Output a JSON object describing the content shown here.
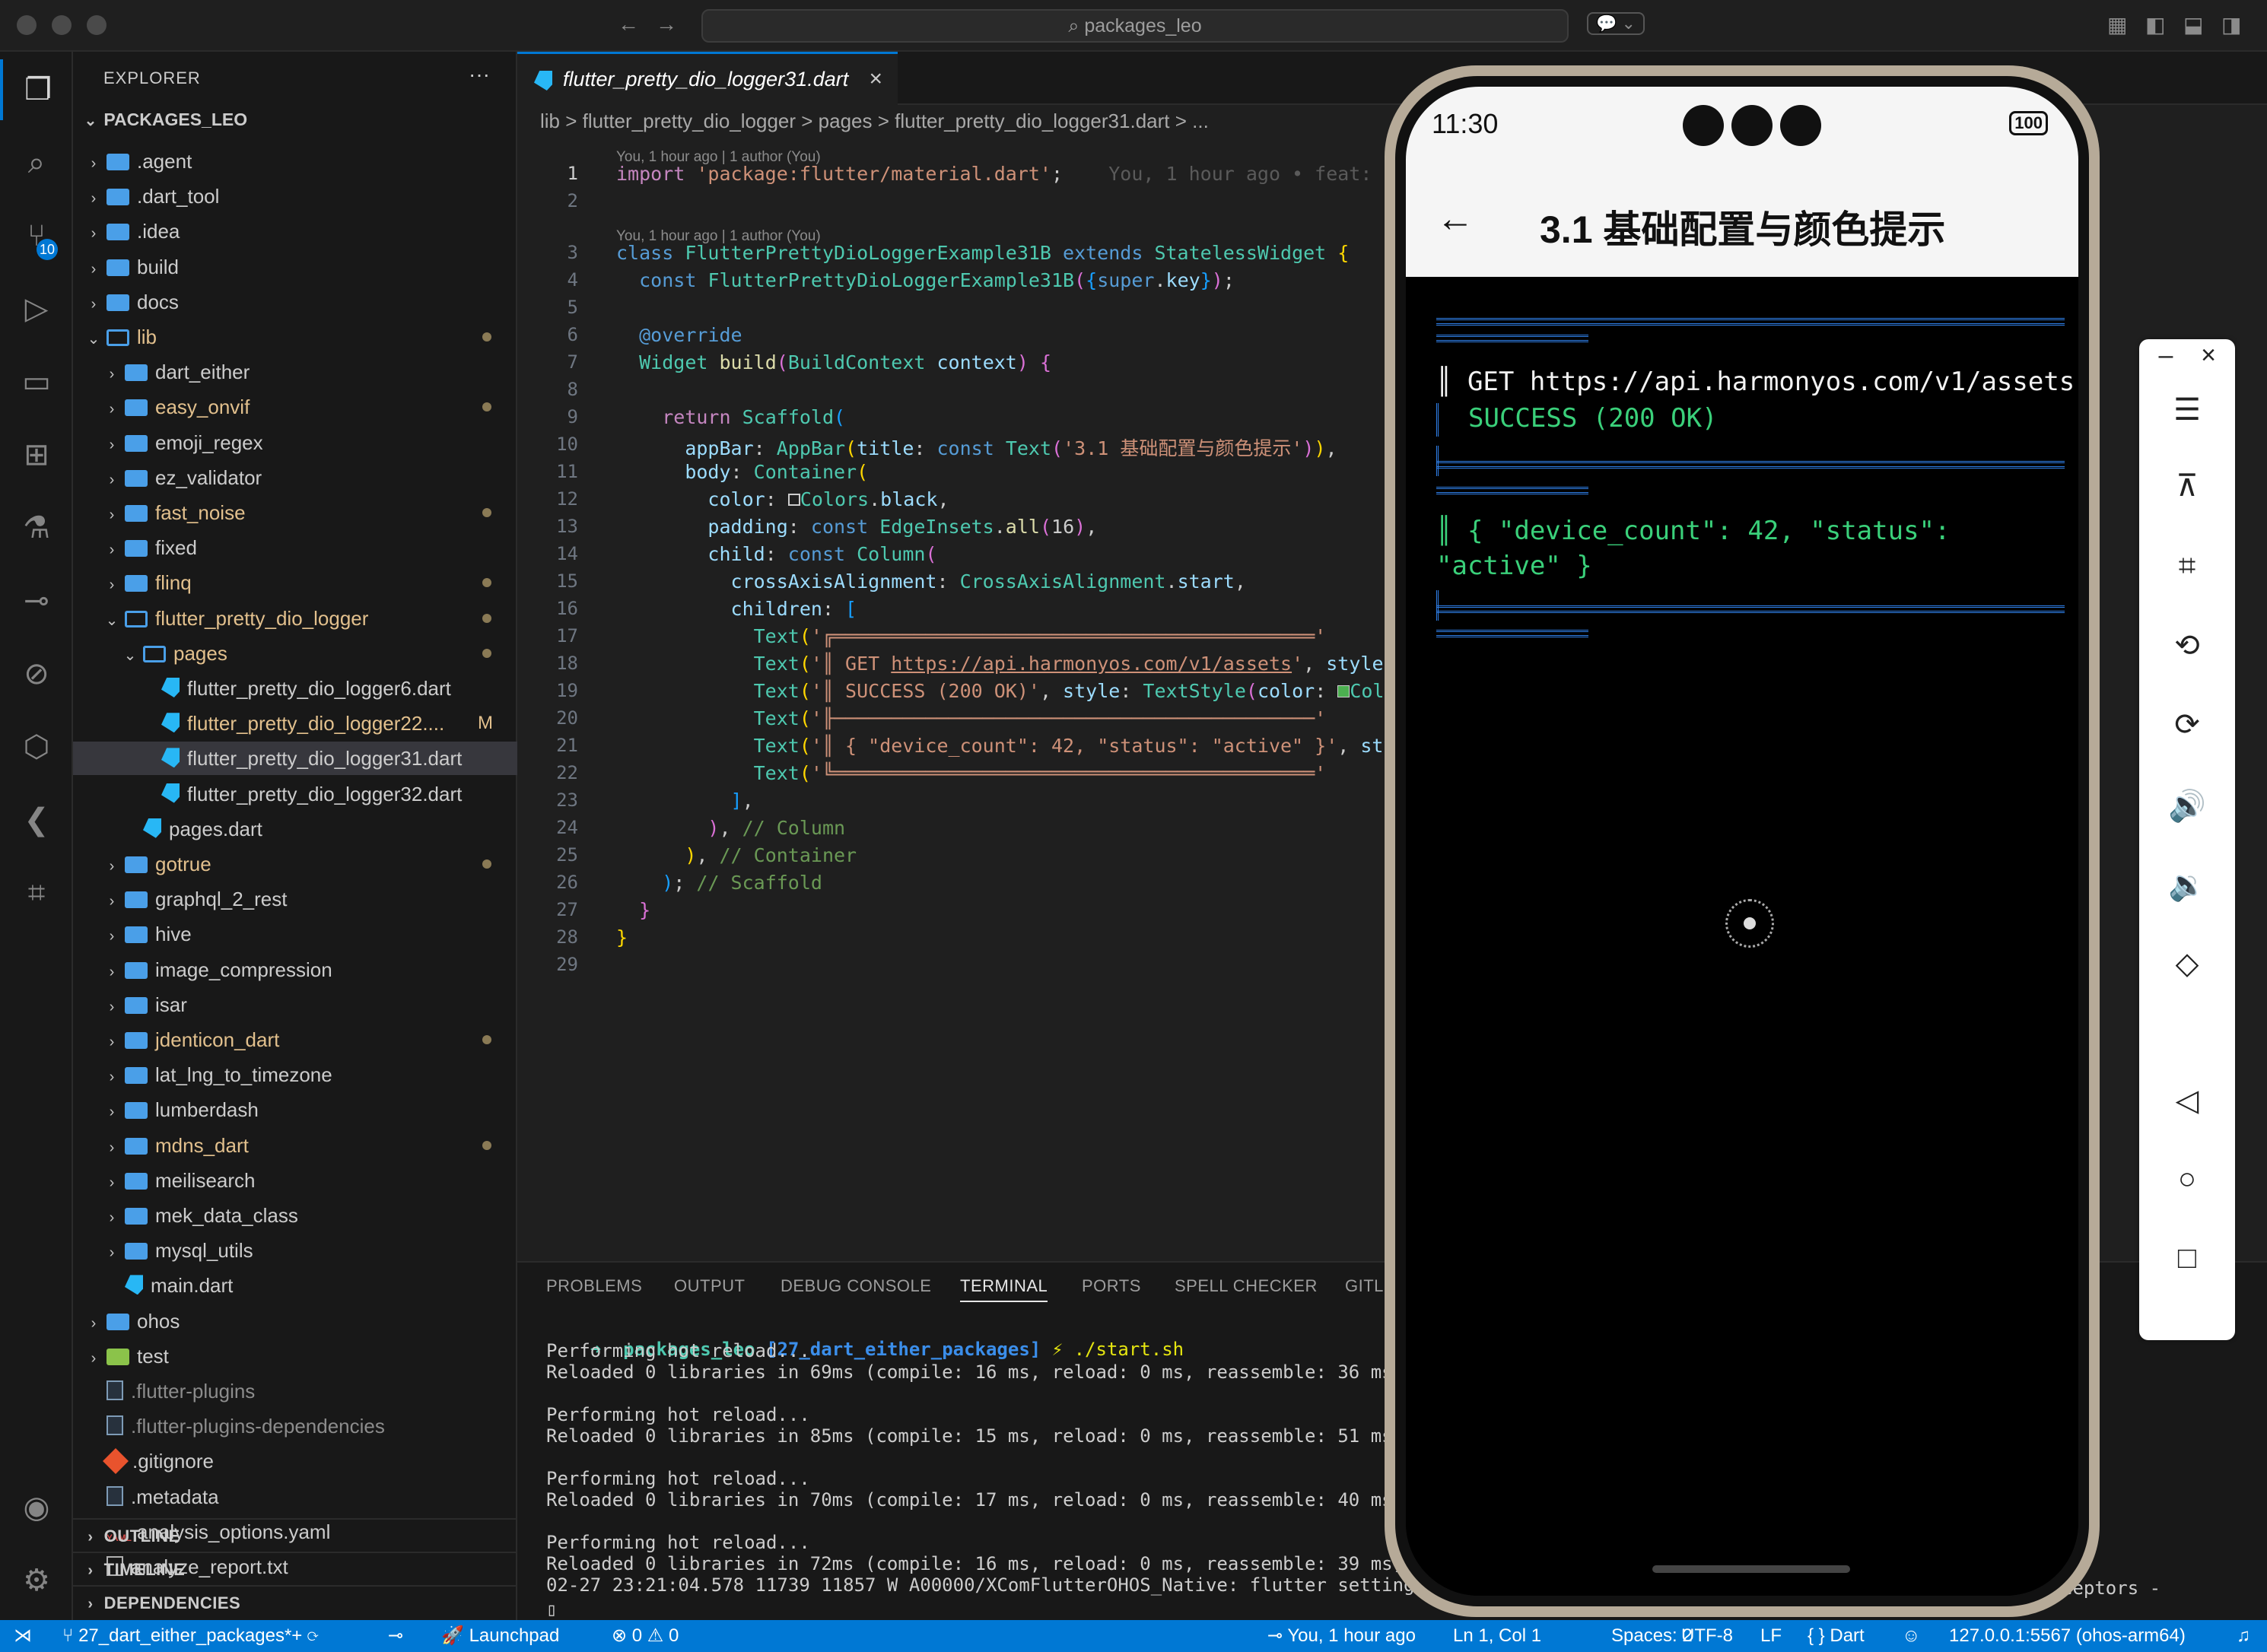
{
  "window": {
    "search": "packages_leo"
  },
  "activity": {
    "scm_badge": "10"
  },
  "explorer": {
    "title": "EXPLORER",
    "root": "PACKAGES_LEO",
    "items": [
      {
        "label": ".agent",
        "depth": 0,
        "kind": "folder"
      },
      {
        "label": ".dart_tool",
        "depth": 0,
        "kind": "folder"
      },
      {
        "label": ".idea",
        "depth": 0,
        "kind": "folder"
      },
      {
        "label": "build",
        "depth": 0,
        "kind": "folder"
      },
      {
        "label": "docs",
        "depth": 0,
        "kind": "folder"
      },
      {
        "label": "lib",
        "depth": 0,
        "kind": "folder-open",
        "mod": true
      },
      {
        "label": "dart_either",
        "depth": 1,
        "kind": "folder"
      },
      {
        "label": "easy_onvif",
        "depth": 1,
        "kind": "folder",
        "mod": true
      },
      {
        "label": "emoji_regex",
        "depth": 1,
        "kind": "folder"
      },
      {
        "label": "ez_validator",
        "depth": 1,
        "kind": "folder"
      },
      {
        "label": "fast_noise",
        "depth": 1,
        "kind": "folder",
        "mod": true
      },
      {
        "label": "fixed",
        "depth": 1,
        "kind": "folder"
      },
      {
        "label": "flinq",
        "depth": 1,
        "kind": "folder",
        "mod": true
      },
      {
        "label": "flutter_pretty_dio_logger",
        "depth": 1,
        "kind": "folder-open",
        "mod": true
      },
      {
        "label": "pages",
        "depth": 2,
        "kind": "folder-open",
        "mod": true
      },
      {
        "label": "flutter_pretty_dio_logger6.dart",
        "depth": 3,
        "kind": "dart"
      },
      {
        "label": "flutter_pretty_dio_logger22....",
        "depth": 3,
        "kind": "dart",
        "letter": "M"
      },
      {
        "label": "flutter_pretty_dio_logger31.dart",
        "depth": 3,
        "kind": "dart",
        "selected": true
      },
      {
        "label": "flutter_pretty_dio_logger32.dart",
        "depth": 3,
        "kind": "dart"
      },
      {
        "label": "pages.dart",
        "depth": 2,
        "kind": "dart"
      },
      {
        "label": "gotrue",
        "depth": 1,
        "kind": "folder",
        "mod": true
      },
      {
        "label": "graphql_2_rest",
        "depth": 1,
        "kind": "folder"
      },
      {
        "label": "hive",
        "depth": 1,
        "kind": "folder"
      },
      {
        "label": "image_compression",
        "depth": 1,
        "kind": "folder"
      },
      {
        "label": "isar",
        "depth": 1,
        "kind": "folder"
      },
      {
        "label": "jdenticon_dart",
        "depth": 1,
        "kind": "folder",
        "mod": true
      },
      {
        "label": "lat_lng_to_timezone",
        "depth": 1,
        "kind": "folder"
      },
      {
        "label": "lumberdash",
        "depth": 1,
        "kind": "folder"
      },
      {
        "label": "mdns_dart",
        "depth": 1,
        "kind": "folder",
        "mod": true
      },
      {
        "label": "meilisearch",
        "depth": 1,
        "kind": "folder"
      },
      {
        "label": "mek_data_class",
        "depth": 1,
        "kind": "folder"
      },
      {
        "label": "mysql_utils",
        "depth": 1,
        "kind": "folder"
      },
      {
        "label": "main.dart",
        "depth": 1,
        "kind": "dart"
      },
      {
        "label": "ohos",
        "depth": 0,
        "kind": "folder"
      },
      {
        "label": "test",
        "depth": 0,
        "kind": "folder-test"
      },
      {
        "label": ".flutter-plugins",
        "depth": 0,
        "kind": "file",
        "dim": true
      },
      {
        "label": ".flutter-plugins-dependencies",
        "depth": 0,
        "kind": "file",
        "dim": true
      },
      {
        "label": ".gitignore",
        "depth": 0,
        "kind": "git"
      },
      {
        "label": ".metadata",
        "depth": 0,
        "kind": "file"
      },
      {
        "label": "analysis_options.yaml",
        "depth": 0,
        "kind": "yaml"
      },
      {
        "label": "analyze_report.txt",
        "depth": 0,
        "kind": "txt"
      }
    ],
    "sections": [
      "OUTLINE",
      "TIMELINE",
      "DEPENDENCIES"
    ]
  },
  "editor": {
    "tab": "flutter_pretty_dio_logger31.dart",
    "breadcrumb": "lib > flutter_pretty_dio_logger > pages > flutter_pretty_dio_logger31.dart > ...",
    "codelens1": "You, 1 hour ago | 1 author (You)",
    "codelens2": "You, 1 hour ago | 1 author (You)",
    "blame": "You, 1 hour ago • feat: r",
    "line_numbers": [
      "1",
      "2",
      "3",
      "4",
      "5",
      "6",
      "7",
      "8",
      "9",
      "10",
      "11",
      "12",
      "13",
      "14",
      "15",
      "16",
      "17",
      "18",
      "19",
      "20",
      "21",
      "22",
      "23",
      "24",
      "25",
      "26",
      "27",
      "28",
      "29"
    ]
  },
  "panel": {
    "tabs": [
      "PROBLEMS",
      "OUTPUT",
      "DEBUG CONSOLE",
      "TERMINAL",
      "PORTS",
      "SPELL CHECKER",
      "GITL"
    ],
    "active_tab": "TERMINAL",
    "prompt_dir": "packages_leo",
    "prompt_branch": "[27_dart_either_packages]",
    "prompt_cmd": "./start.sh",
    "lines": [
      "Performing hot reload...",
      "Reloaded 0 libraries in 69ms (compile: 16 ms, reload: 0 ms, reassemble: 36 ms).",
      "",
      "Performing hot reload...",
      "Reloaded 0 libraries in 85ms (compile: 15 ms, reload: 0 ms, reassemble: 51 ms).",
      "",
      "Performing hot reload...",
      "Reloaded 0 libraries in 70ms (compile: 17 ms, reload: 0 ms, reassemble: 40 ms).",
      "",
      "Performing hot reload...",
      "Reloaded 0 libraries in 72ms (compile: 16 ms, reload: 0 ms, reassemble: 39 ms).",
      "02-27 23:21:04.578 11739 11857 W A00000/XComFlutterOHOS_Native: flutter settings"
    ],
    "tail": "ceptors -"
  },
  "statusbar": {
    "branch": "27_dart_either_packages*+",
    "launchpad": "Launchpad",
    "problems": "0",
    "warnings": "0",
    "blame": "You, 1 hour ago",
    "position": "Ln 1, Col 1",
    "spaces": "Spaces: 2",
    "encoding": "UTF-8",
    "eol": "LF",
    "language": "Dart",
    "device": "127.0.0.1:5567 (ohos-arm64)"
  },
  "phone": {
    "time": "11:30",
    "battery": "100",
    "app_title": "3.1 基础配置与颜色提示",
    "log_get": "║ GET https://api.harmonyos.com/v1/assets",
    "log_success": "SUCCESS (200 OK)",
    "log_json_1": "║ { \"device_count\": 42, \"status\":",
    "log_json_2": "\"active\" }"
  },
  "colors": {
    "accent": "#0078d4",
    "log_green": "#3ad07a",
    "log_blue": "#2f7fe8"
  }
}
